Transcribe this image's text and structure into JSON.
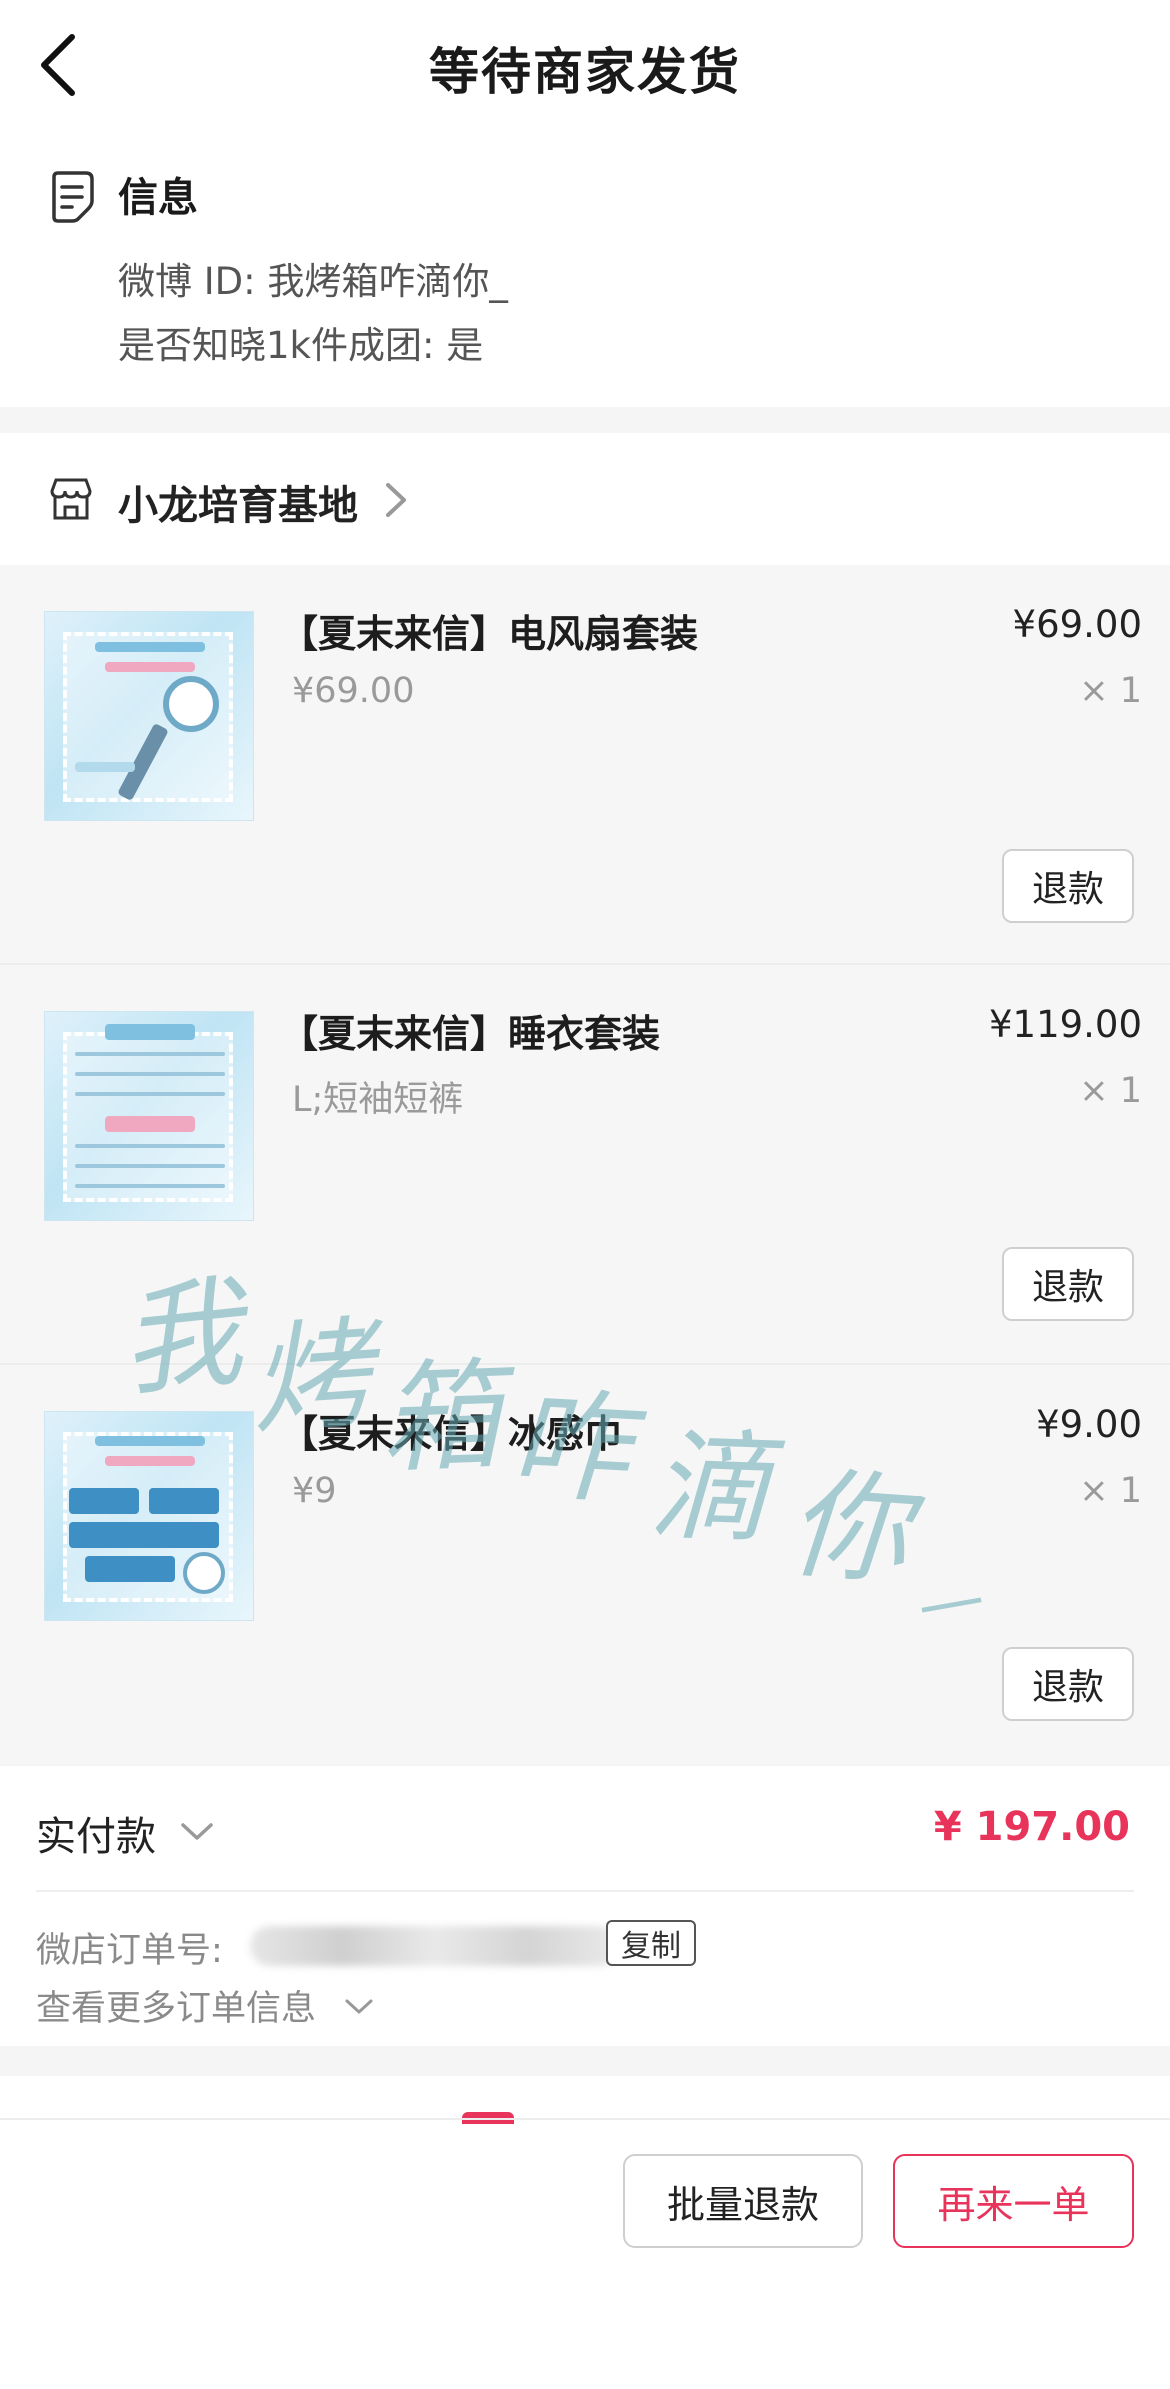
{
  "header": {
    "title": "等待商家发货"
  },
  "info": {
    "title": "信息",
    "weibo_line": "微博 ID: 我烤箱咋滴你_",
    "group_line": "是否知晓1k件成团: 是"
  },
  "shop": {
    "name": "小龙培育基地"
  },
  "items": [
    {
      "name": "【夏末来信】电风扇套装",
      "spec": "¥69.00",
      "price": "¥69.00",
      "qty": "× 1",
      "refund_label": "退款"
    },
    {
      "name": "【夏末来信】睡衣套装",
      "spec": "L;短袖短裤",
      "price": "¥119.00",
      "qty": "× 1",
      "refund_label": "退款"
    },
    {
      "name": "【夏末来信】冰感巾",
      "spec": "¥9",
      "price": "¥9.00",
      "qty": "× 1",
      "refund_label": "退款"
    }
  ],
  "payment": {
    "label": "实付款",
    "amount": "¥ 197.00",
    "order_label": "微店订单号:",
    "copy_label": "复制",
    "more_info": "查看更多订单信息"
  },
  "bottom": {
    "batch_refund": "批量退款",
    "reorder": "再来一单"
  },
  "watermark": {
    "text": "我烤箱咋滴你_"
  },
  "colors": {
    "accent": "#e8335a",
    "background": "#f5f5f5"
  }
}
